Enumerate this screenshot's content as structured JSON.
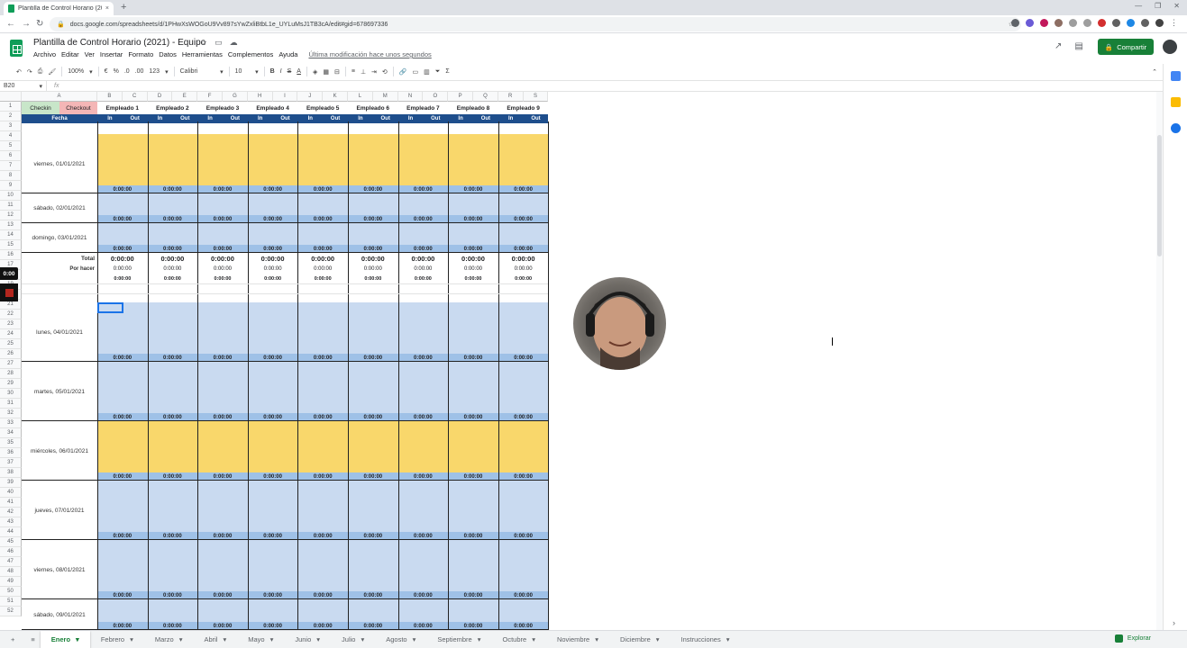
{
  "browser": {
    "tab_title": "Plantilla de Control Horario (20...",
    "tab_close": "×",
    "new_tab": "+",
    "url": "docs.google.com/spreadsheets/d/1PHwXsWOGoU9Vv897sYwZxliBtbL1e_UYLuMsJ1TB3cA/edit#gid=678697336",
    "window_controls": [
      "—",
      "❐",
      "✕"
    ]
  },
  "doc": {
    "title": "Plantilla de Control Horario (2021) - Equipo",
    "menu": [
      "Archivo",
      "Editar",
      "Ver",
      "Insertar",
      "Formato",
      "Datos",
      "Herramientas",
      "Complementos",
      "Ayuda"
    ],
    "last_edit": "Última modificación hace unos segundos",
    "share_label": "Compartir"
  },
  "toolbar": {
    "zoom": "100%",
    "currency": "€",
    "percent": "%",
    "dec_less": ".0",
    "dec_more": ".00",
    "format": "123",
    "font": "Calibri",
    "font_size": "10",
    "bold": "B",
    "italic": "I",
    "strike": "S",
    "textcolor": "A",
    "sum": "Σ"
  },
  "formula_bar": {
    "cell_ref": "B20",
    "fx": "fx",
    "value": ""
  },
  "sheet": {
    "col_letters": [
      "A",
      "B",
      "C",
      "D",
      "E",
      "F",
      "G",
      "H",
      "I",
      "J",
      "K",
      "L",
      "M",
      "N",
      "O",
      "P",
      "Q",
      "R",
      "S"
    ],
    "row_numbers": [
      "1",
      "2",
      "3",
      "4",
      "5",
      "6",
      "7",
      "8",
      "9",
      "10",
      "11",
      "12",
      "13",
      "14",
      "15",
      "16",
      "17",
      "18",
      "19",
      "20",
      "21",
      "22",
      "23",
      "24",
      "25",
      "26",
      "27",
      "28",
      "29",
      "30",
      "31",
      "32",
      "33",
      "34",
      "35",
      "36",
      "37",
      "38",
      "39",
      "40",
      "41",
      "42",
      "43",
      "44",
      "45",
      "46",
      "47",
      "48",
      "49",
      "50",
      "51",
      "52"
    ],
    "checkin": "Checkin",
    "checkout": "Checkout",
    "fecha": "Fecha",
    "in_label": "In",
    "out_label": "Out",
    "employees": [
      "Empleado 1",
      "Empleado 2",
      "Empleado 3",
      "Empleado 4",
      "Empleado 5",
      "Empleado 6",
      "Empleado 7",
      "Empleado 8",
      "Empleado 9"
    ],
    "zero_time": "0:00:00",
    "total_label": "Total",
    "por_hacer_label": "Por hacer",
    "days": [
      {
        "label": "viernes, 01/01/2021",
        "color": "yellow"
      },
      {
        "label": "sábado, 02/01/2021",
        "color": "blue"
      },
      {
        "label": "domingo, 03/01/2021",
        "color": "blue"
      },
      {
        "label": "lunes, 04/01/2021",
        "color": "blue"
      },
      {
        "label": "martes, 05/01/2021",
        "color": "blue"
      },
      {
        "label": "miércoles, 06/01/2021",
        "color": "yellow"
      },
      {
        "label": "jueves, 07/01/2021",
        "color": "blue"
      },
      {
        "label": "viernes, 08/01/2021",
        "color": "blue"
      },
      {
        "label": "sábado, 09/01/2021",
        "color": "blue"
      }
    ]
  },
  "sheet_tabs": [
    "Enero",
    "Febrero",
    "Marzo",
    "Abril",
    "Mayo",
    "Junio",
    "Julio",
    "Agosto",
    "Septiembre",
    "Octubre",
    "Noviembre",
    "Diciembre",
    "Instrucciones"
  ],
  "explore_label": "Explorar",
  "recording": {
    "timer": "0:00"
  },
  "colors": {
    "accent_green": "#188038",
    "header_blue": "#1e4e8c",
    "yellow": "#f9d76b",
    "light_blue": "#c9daf0"
  }
}
